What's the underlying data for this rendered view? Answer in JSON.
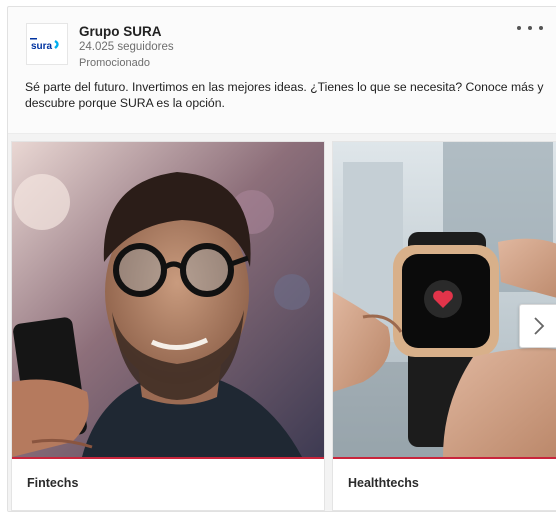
{
  "post": {
    "company": "Grupo SURA",
    "logo_text": "sura",
    "followers": "24.025 seguidores",
    "promoted": "Promocionado",
    "text": "Sé parte del futuro. Invertimos en las mejores ideas. ¿Tienes lo que se necesita? Conoce más y descubre porque SURA es la opción."
  },
  "carousel": {
    "cards": [
      {
        "label": "Fintechs",
        "image": "man-with-glasses-holding-phone"
      },
      {
        "label": "Healthtechs",
        "image": "smartwatch-heart-icon"
      }
    ],
    "next_icon": "chevron-right-icon"
  },
  "colors": {
    "accent": "#c9253c",
    "logo_blue": "#0033a0",
    "logo_cyan": "#00aeef"
  }
}
